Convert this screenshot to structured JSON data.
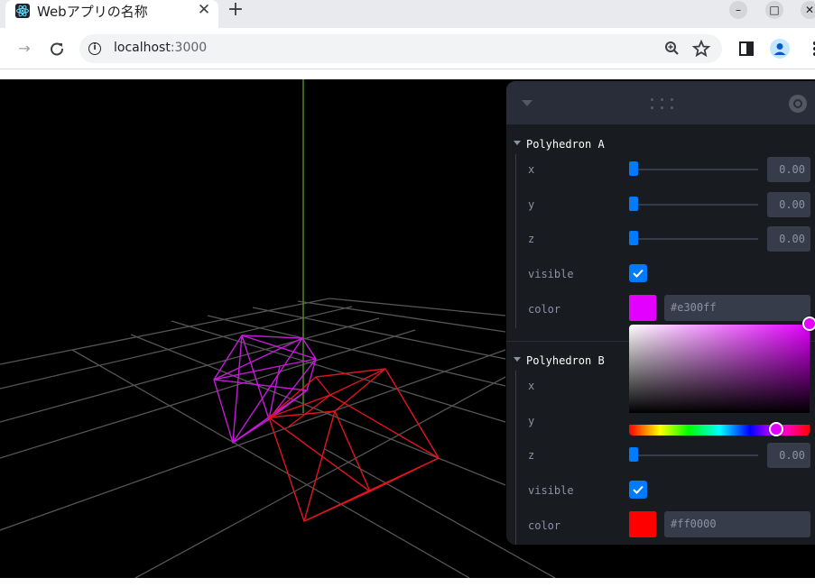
{
  "browser": {
    "tab_title": "Webアプリの名称",
    "tab_close": "✕",
    "new_tab": "+",
    "url_host": "localhost",
    "url_port": ":3000",
    "icons": [
      "react-favicon-icon",
      "close-icon",
      "plus-icon",
      "minimize-icon",
      "maximize-icon",
      "close-window-icon",
      "forward-icon",
      "reload-icon",
      "info-icon",
      "zoom-icon",
      "star-icon",
      "side-panel-icon",
      "profile-icon",
      "menu-dots-icon"
    ]
  },
  "scene": {
    "description_colors": {
      "background": "#000000",
      "grid": "#555555",
      "axis": "#4c8a1a",
      "polyhedron_a": "#e300ff",
      "polyhedron_b": "#ff0000"
    }
  },
  "panel": {
    "folders": [
      {
        "title": "Polyhedron A",
        "rows": {
          "x_label": "x",
          "x_value": "0.00",
          "x_fraction": 0,
          "y_label": "y",
          "y_value": "0.00",
          "y_fraction": 0,
          "z_label": "z",
          "z_value": "0.00",
          "z_fraction": 0,
          "visible_label": "visible",
          "visible": true,
          "color_label": "color",
          "color_value": "#e300ff"
        }
      },
      {
        "title": "Polyhedron B",
        "rows": {
          "x_label": "x",
          "y_label": "y",
          "z_label": "z",
          "z_value": "0.00",
          "z_fraction": 0,
          "visible_label": "visible",
          "visible": true,
          "color_label": "color",
          "color_value": "#ff0000"
        }
      }
    ],
    "picker_open_for": "Polyhedron A",
    "accent": "#007bff"
  }
}
